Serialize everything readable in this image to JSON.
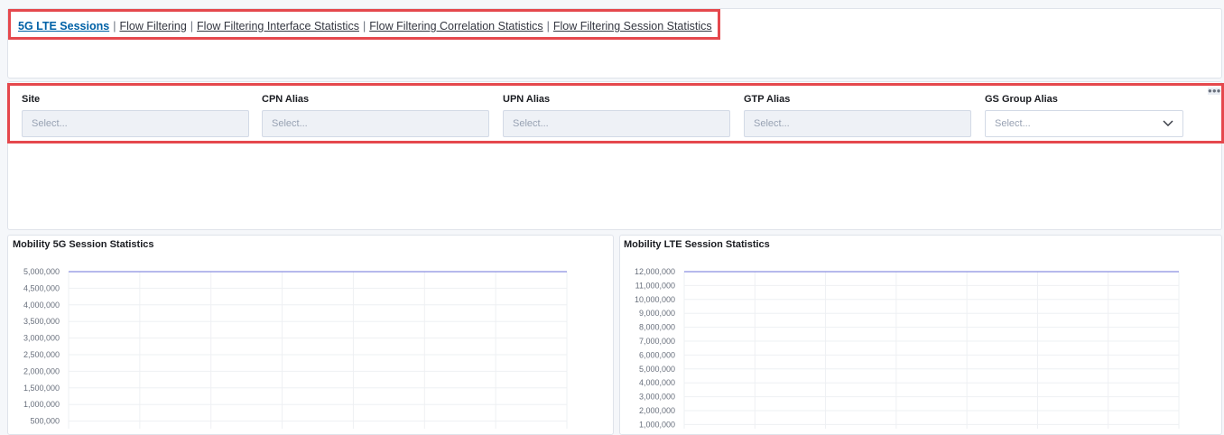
{
  "nav": {
    "links": [
      "5G LTE Sessions",
      "Flow Filtering",
      "Flow Filtering Interface Statistics",
      "Flow Filtering Correlation Statistics",
      "Flow Filtering Session Statistics"
    ],
    "separator": "|"
  },
  "controls": [
    {
      "label": "Site",
      "placeholder": "Select..."
    },
    {
      "label": "CPN Alias",
      "placeholder": "Select..."
    },
    {
      "label": "UPN Alias",
      "placeholder": "Select..."
    },
    {
      "label": "GTP Alias",
      "placeholder": "Select..."
    },
    {
      "label": "GS Group Alias",
      "placeholder": "Select..."
    }
  ],
  "options_icon": "ellipsis-icon",
  "chart_data": [
    {
      "type": "line",
      "title": "Mobility 5G Session Statistics",
      "y_ticks": [
        "5,000,000",
        "4,500,000",
        "4,000,000",
        "3,500,000",
        "3,000,000",
        "2,500,000",
        "2,000,000",
        "1,500,000",
        "1,000,000",
        "500,000"
      ],
      "ylim": [
        500000,
        5000000
      ],
      "series": [
        {
          "values": [
            5000000,
            5000000
          ]
        }
      ],
      "grid": true
    },
    {
      "type": "line",
      "title": "Mobility LTE Session Statistics",
      "y_ticks": [
        "12,000,000",
        "11,000,000",
        "10,000,000",
        "9,000,000",
        "8,000,000",
        "7,000,000",
        "6,000,000",
        "5,000,000",
        "4,000,000",
        "3,000,000",
        "2,000,000",
        "1,000,000"
      ],
      "ylim": [
        1000000,
        12000000
      ],
      "series": [
        {
          "values": [
            12000000,
            12000000
          ]
        }
      ],
      "grid": true
    }
  ]
}
